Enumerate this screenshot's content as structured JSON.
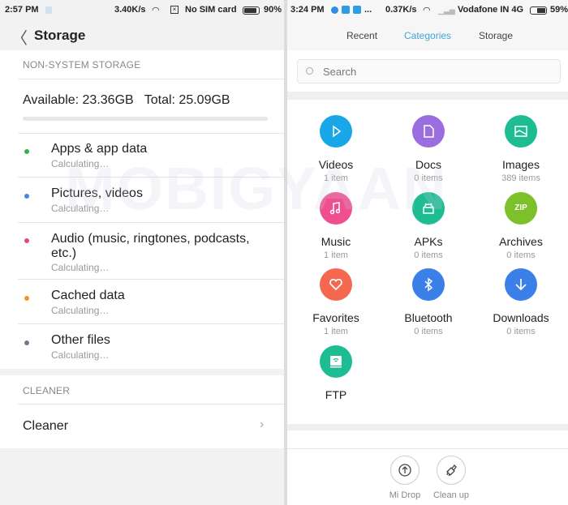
{
  "left": {
    "status": {
      "time": "2:57 PM",
      "speed": "3.40K/s",
      "sim": "No SIM card",
      "battery": "90%"
    },
    "header": {
      "title": "Storage"
    },
    "section1": "NON-SYSTEM STORAGE",
    "summary": "Available: 23.36GB   Total: 25.09GB",
    "items": [
      {
        "label": "Apps & app data",
        "sub": "Calculating…",
        "color": "#3fae49"
      },
      {
        "label": "Pictures, videos",
        "sub": "Calculating…",
        "color": "#4a86e0"
      },
      {
        "label": "Audio (music, ringtones, podcasts, etc.)",
        "sub": "Calculating…",
        "color": "#e8457e"
      },
      {
        "label": "Cached data",
        "sub": "Calculating…",
        "color": "#f0962a"
      },
      {
        "label": "Other files",
        "sub": "Calculating…",
        "color": "#6e7b8e"
      }
    ],
    "section2": "CLEANER",
    "cleaner": "Cleaner"
  },
  "right": {
    "status": {
      "time": "3:24 PM",
      "more": "...",
      "speed": "0.37K/s",
      "carrier": "Vodafone IN 4G",
      "battery": "59%"
    },
    "tabs": [
      {
        "label": "Recent"
      },
      {
        "label": "Categories",
        "active": true
      },
      {
        "label": "Storage"
      }
    ],
    "search": {
      "placeholder": "Search"
    },
    "categories": [
      {
        "name": "Videos",
        "count": "1 item",
        "color": "#1aa7e8",
        "icon": "play-icon"
      },
      {
        "name": "Docs",
        "count": "0 items",
        "color": "#9b6ee0",
        "icon": "document-icon"
      },
      {
        "name": "Images",
        "count": "389 items",
        "color": "#1ebc93",
        "icon": "image-icon"
      },
      {
        "name": "Music",
        "count": "1 item",
        "color": "#ef4f8f",
        "icon": "music-icon"
      },
      {
        "name": "APKs",
        "count": "0 items",
        "color": "#1ebc93",
        "icon": "android-icon"
      },
      {
        "name": "Archives",
        "count": "0 items",
        "color": "#7cc02a",
        "icon": "zip-icon",
        "glyph": "ZIP"
      },
      {
        "name": "Favorites",
        "count": "1 item",
        "color": "#f4684f",
        "icon": "heart-icon"
      },
      {
        "name": "Bluetooth",
        "count": "0 items",
        "color": "#3b7fe8",
        "icon": "bluetooth-icon"
      },
      {
        "name": "Downloads",
        "count": "0 items",
        "color": "#3b7fe8",
        "icon": "download-icon"
      },
      {
        "name": "FTP",
        "count": "",
        "color": "#1ebc93",
        "icon": "ftp-icon"
      }
    ],
    "bottom": [
      {
        "label": "Mi Drop",
        "icon": "upload-icon"
      },
      {
        "label": "Clean up",
        "icon": "broom-icon"
      }
    ]
  },
  "accent": "#3ea6d8",
  "watermark": "MOBIGYAAN"
}
